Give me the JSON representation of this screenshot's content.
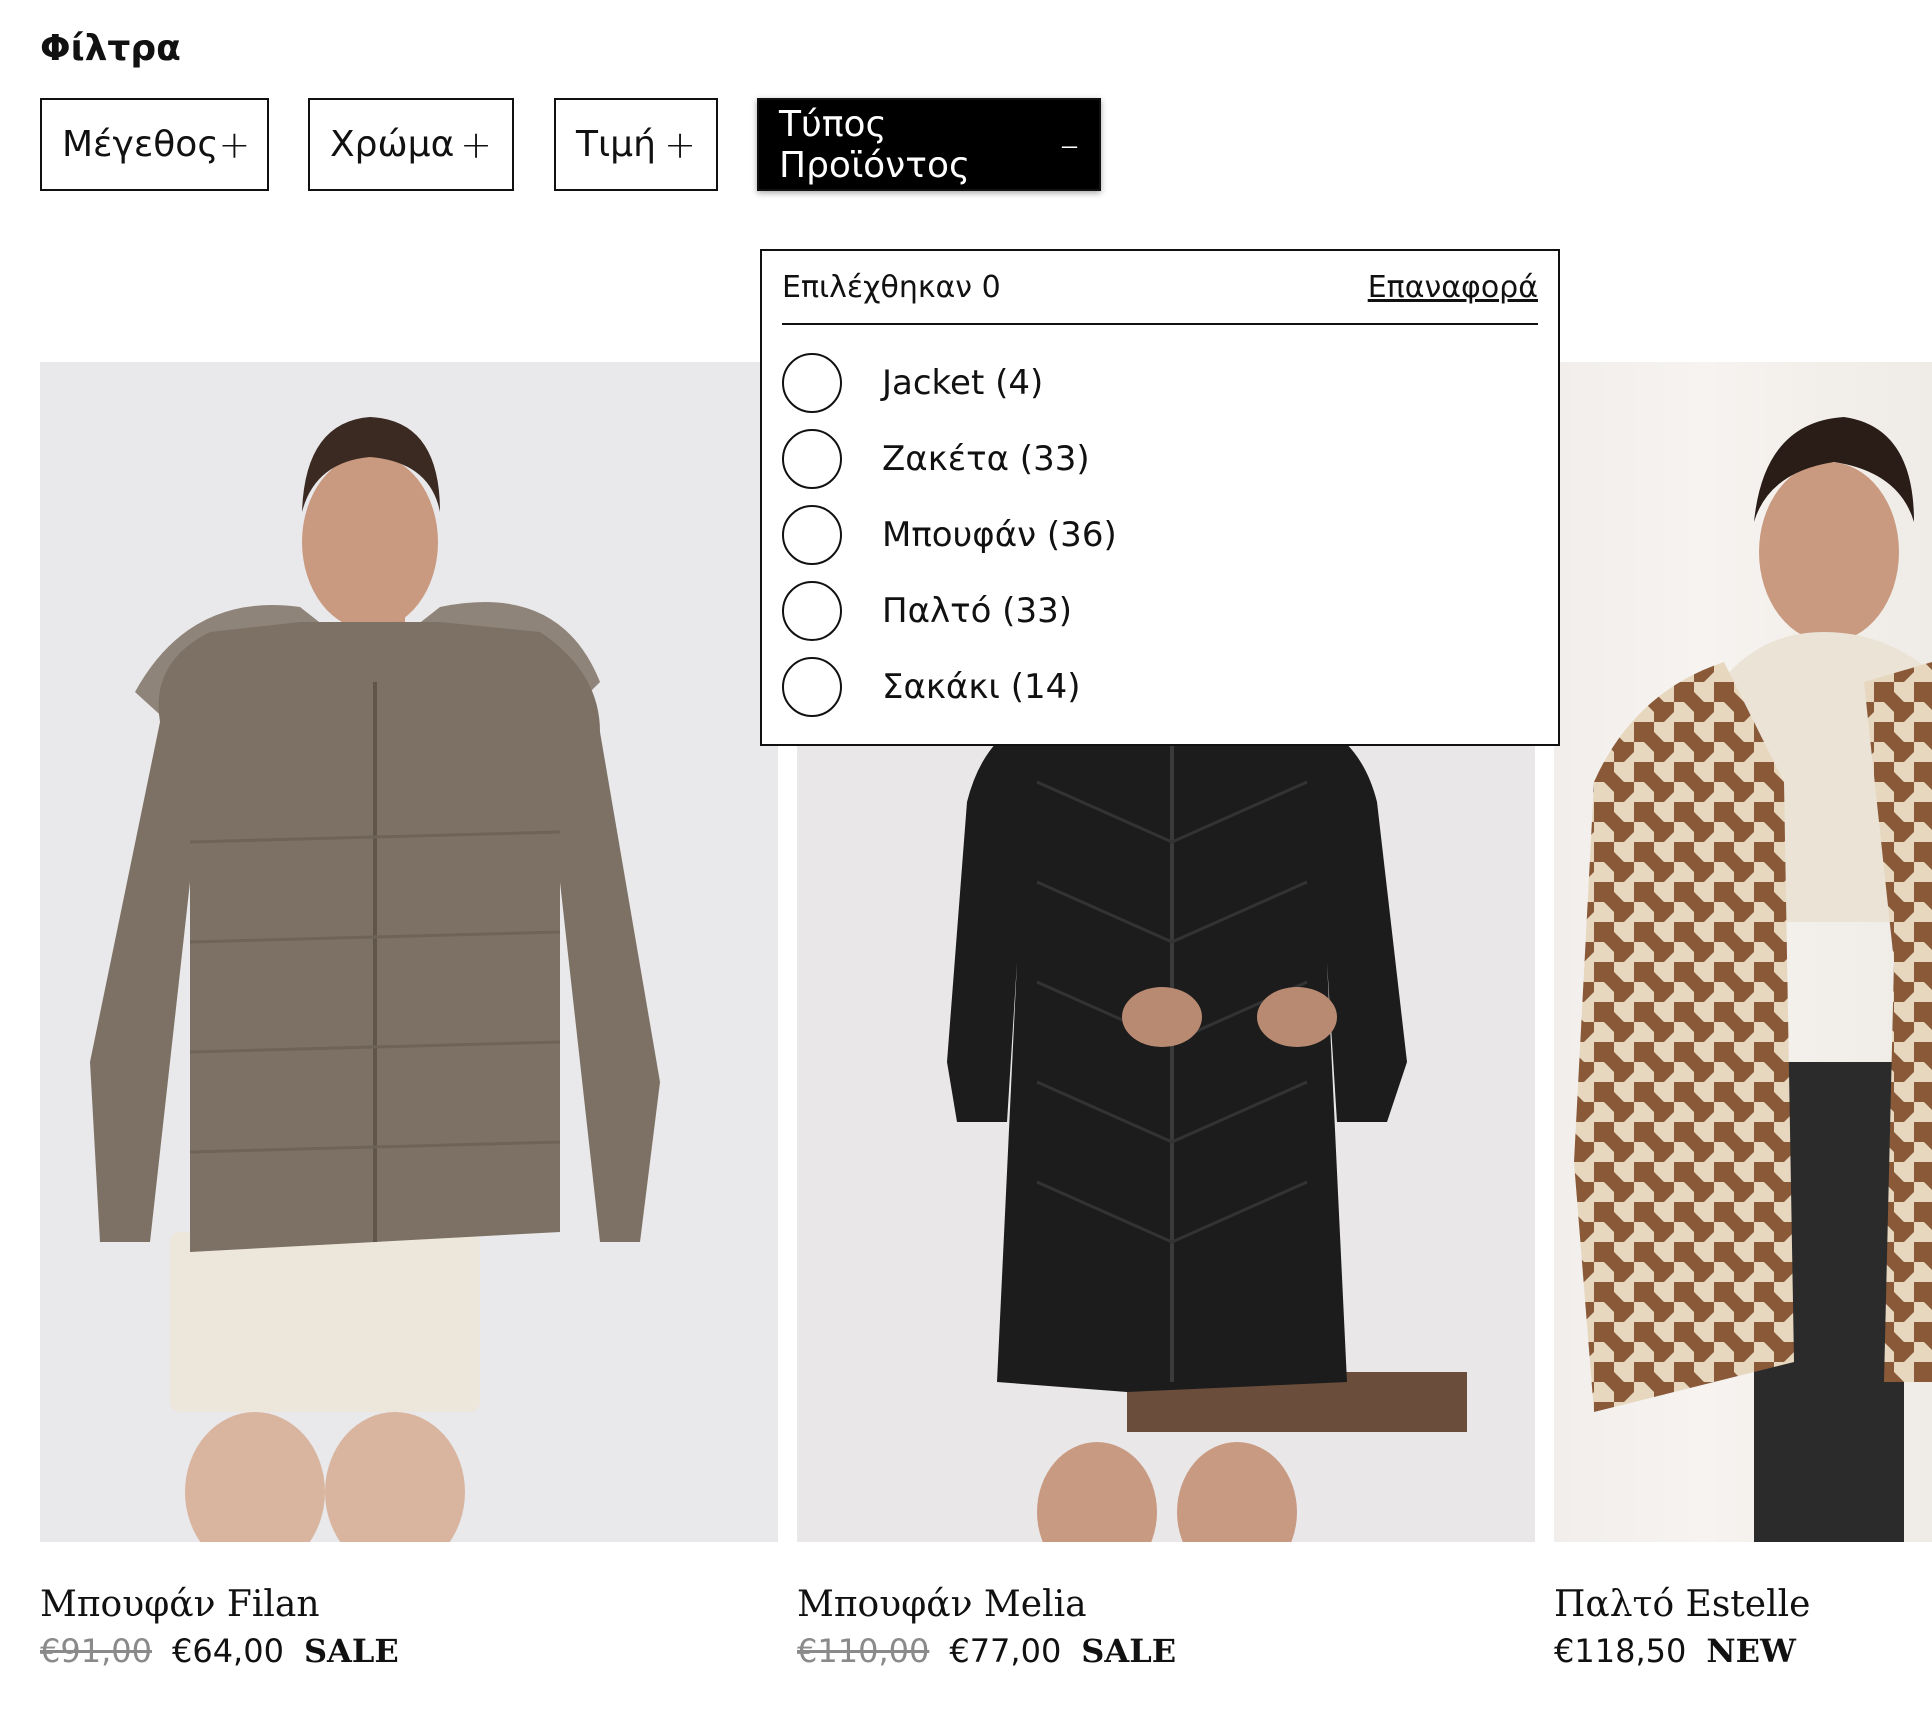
{
  "filters": {
    "title": "Φίλτρα",
    "buttons": [
      {
        "label": "Μέγεθος",
        "symbol": "+"
      },
      {
        "label": "Χρώμα",
        "symbol": "+"
      },
      {
        "label": "Τιμή",
        "symbol": "+"
      },
      {
        "label": "Τύπος Προϊόντος",
        "symbol": "–"
      }
    ]
  },
  "dropdown": {
    "selected_text": "Επιλέχθηκαν 0",
    "reset_label": "Επαναφορά",
    "options": [
      {
        "label": "Jacket (4)"
      },
      {
        "label": "Ζακέτα (33)"
      },
      {
        "label": "Μπουφάν (36)"
      },
      {
        "label": "Παλτό (33)"
      },
      {
        "label": "Σακάκι (14)"
      }
    ]
  },
  "products": [
    {
      "name": "Μπουφάν Filan",
      "old_price": "€91,00",
      "price": "€64,00",
      "tag": "SALE"
    },
    {
      "name": "Μπουφάν Melia",
      "old_price": "€110,00",
      "price": "€77,00",
      "tag": "SALE"
    },
    {
      "name": "Παλτό Estelle",
      "price": "€118,50",
      "tag": "NEW"
    }
  ],
  "colors": {
    "active_filter_bg": "#000000",
    "old_price": "#8a8a8a"
  }
}
